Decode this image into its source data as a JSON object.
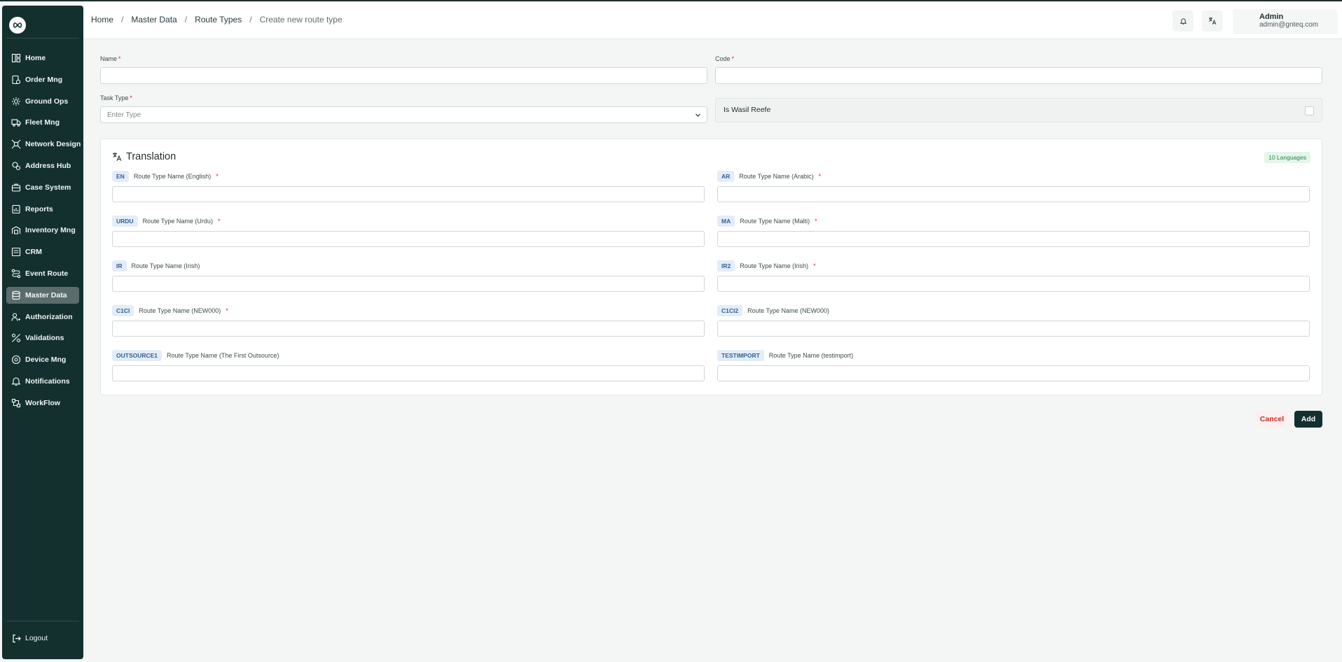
{
  "sidebar": {
    "items": [
      {
        "label": "Home",
        "icon": "dashboard-icon"
      },
      {
        "label": "Order Mng",
        "icon": "order-icon"
      },
      {
        "label": "Ground Ops",
        "icon": "ground-ops-icon"
      },
      {
        "label": "Fleet Mng",
        "icon": "truck-icon"
      },
      {
        "label": "Network Design",
        "icon": "network-icon"
      },
      {
        "label": "Address Hub",
        "icon": "location-icon"
      },
      {
        "label": "Case System",
        "icon": "case-icon"
      },
      {
        "label": "Reports",
        "icon": "report-icon"
      },
      {
        "label": "Inventory Mng",
        "icon": "inventory-icon"
      },
      {
        "label": "CRM",
        "icon": "crm-icon"
      },
      {
        "label": "Event Route",
        "icon": "route-icon"
      },
      {
        "label": "Master Data",
        "icon": "database-icon",
        "active": true
      },
      {
        "label": "Authorization",
        "icon": "users-icon"
      },
      {
        "label": "Validations",
        "icon": "validation-icon"
      },
      {
        "label": "Device Mng",
        "icon": "device-icon"
      },
      {
        "label": "Notifications",
        "icon": "bell-icon"
      },
      {
        "label": "WorkFlow",
        "icon": "workflow-icon"
      }
    ],
    "logout_label": "Logout"
  },
  "header": {
    "breadcrumb": [
      "Home",
      "Master Data",
      "Route Types",
      "Create new route type"
    ],
    "user_name": "Admin",
    "user_email": "admin@gnteq.com"
  },
  "form": {
    "name_label": "Name",
    "name_value": "",
    "code_label": "Code",
    "code_value": "",
    "task_type_label": "Task Type",
    "task_type_placeholder": "Enter Type",
    "is_wasil_label": "Is Wasil Reefe",
    "required_mark": "*"
  },
  "translation": {
    "title": "Translation",
    "badge": "10 Languages",
    "fields": [
      {
        "code": "EN",
        "label": "Route Type Name (English)",
        "required": true,
        "value": ""
      },
      {
        "code": "AR",
        "label": "Route Type Name (Arabic)",
        "required": true,
        "value": ""
      },
      {
        "code": "URDU",
        "label": "Route Type Name (Urdu)",
        "required": true,
        "value": ""
      },
      {
        "code": "MA",
        "label": "Route Type Name (Malti)",
        "required": true,
        "value": ""
      },
      {
        "code": "IR",
        "label": "Route Type Name (Irish)",
        "required": false,
        "value": ""
      },
      {
        "code": "IR2",
        "label": "Route Type Name (Irish)",
        "required": true,
        "value": ""
      },
      {
        "code": "C1CI",
        "label": "Route Type Name (NEW000)",
        "required": true,
        "value": ""
      },
      {
        "code": "C1CI2",
        "label": "Route Type Name (NEW000)",
        "required": false,
        "value": ""
      },
      {
        "code": "OUTSOURCE1",
        "label": "Route Type Name (The First Outsource)",
        "required": false,
        "value": ""
      },
      {
        "code": "TESTIMPORT",
        "label": "Route Type Name (testimport)",
        "required": false,
        "value": ""
      }
    ]
  },
  "actions": {
    "cancel_label": "Cancel",
    "add_label": "Add"
  },
  "colors": {
    "sidebar_bg": "#13302f",
    "active_item": "#5b6c6c",
    "required": "#e02424",
    "cancel_text": "#d12a2a",
    "badge_text": "#1f8a47",
    "code_tag_text": "#2f5f97"
  }
}
